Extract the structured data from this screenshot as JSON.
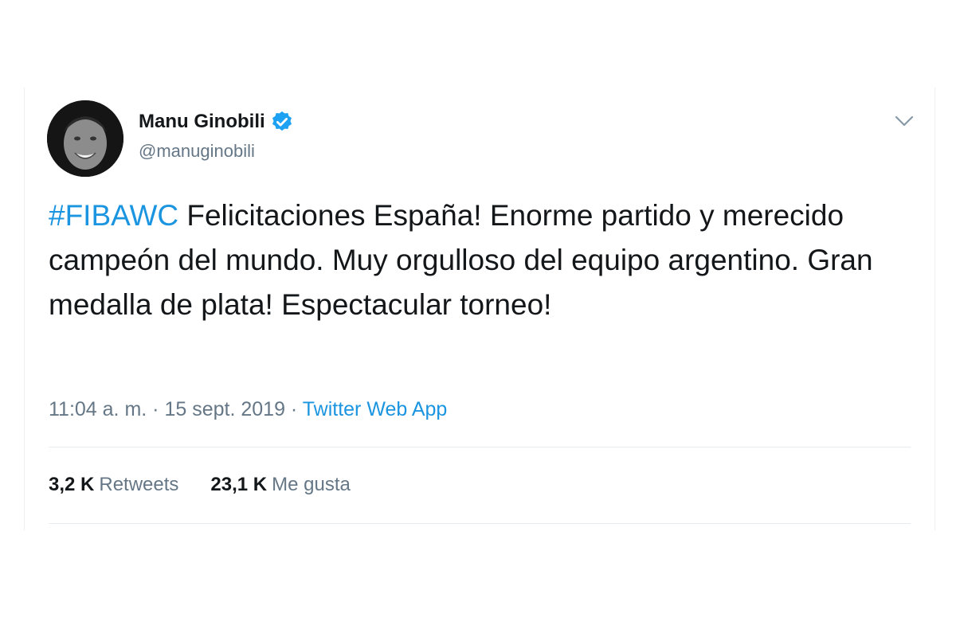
{
  "user": {
    "display_name": "Manu Ginobili",
    "handle": "@manuginobili",
    "verified_icon": "verified-badge-icon",
    "avatar_icon": "avatar-photo"
  },
  "tweet": {
    "hashtag": "#FIBAWC",
    "text": " Felicitaciones España! Enorme partido y merecido campeón del mundo. Muy orgulloso del equipo argentino. Gran medalla de plata! Espectacular torneo!",
    "time": "11:04 a. m.",
    "separator": "·",
    "date": "15 sept. 2019",
    "source": "Twitter Web App"
  },
  "stats": {
    "retweets_count": "3,2 K",
    "retweets_label": "Retweets",
    "likes_count": "23,1 K",
    "likes_label": "Me gusta"
  },
  "colors": {
    "link": "#1b95e0",
    "text": "#14171a",
    "secondary": "#657786",
    "verified": "#1da1f2"
  },
  "icons": {
    "caret": "chevron-down-icon"
  }
}
